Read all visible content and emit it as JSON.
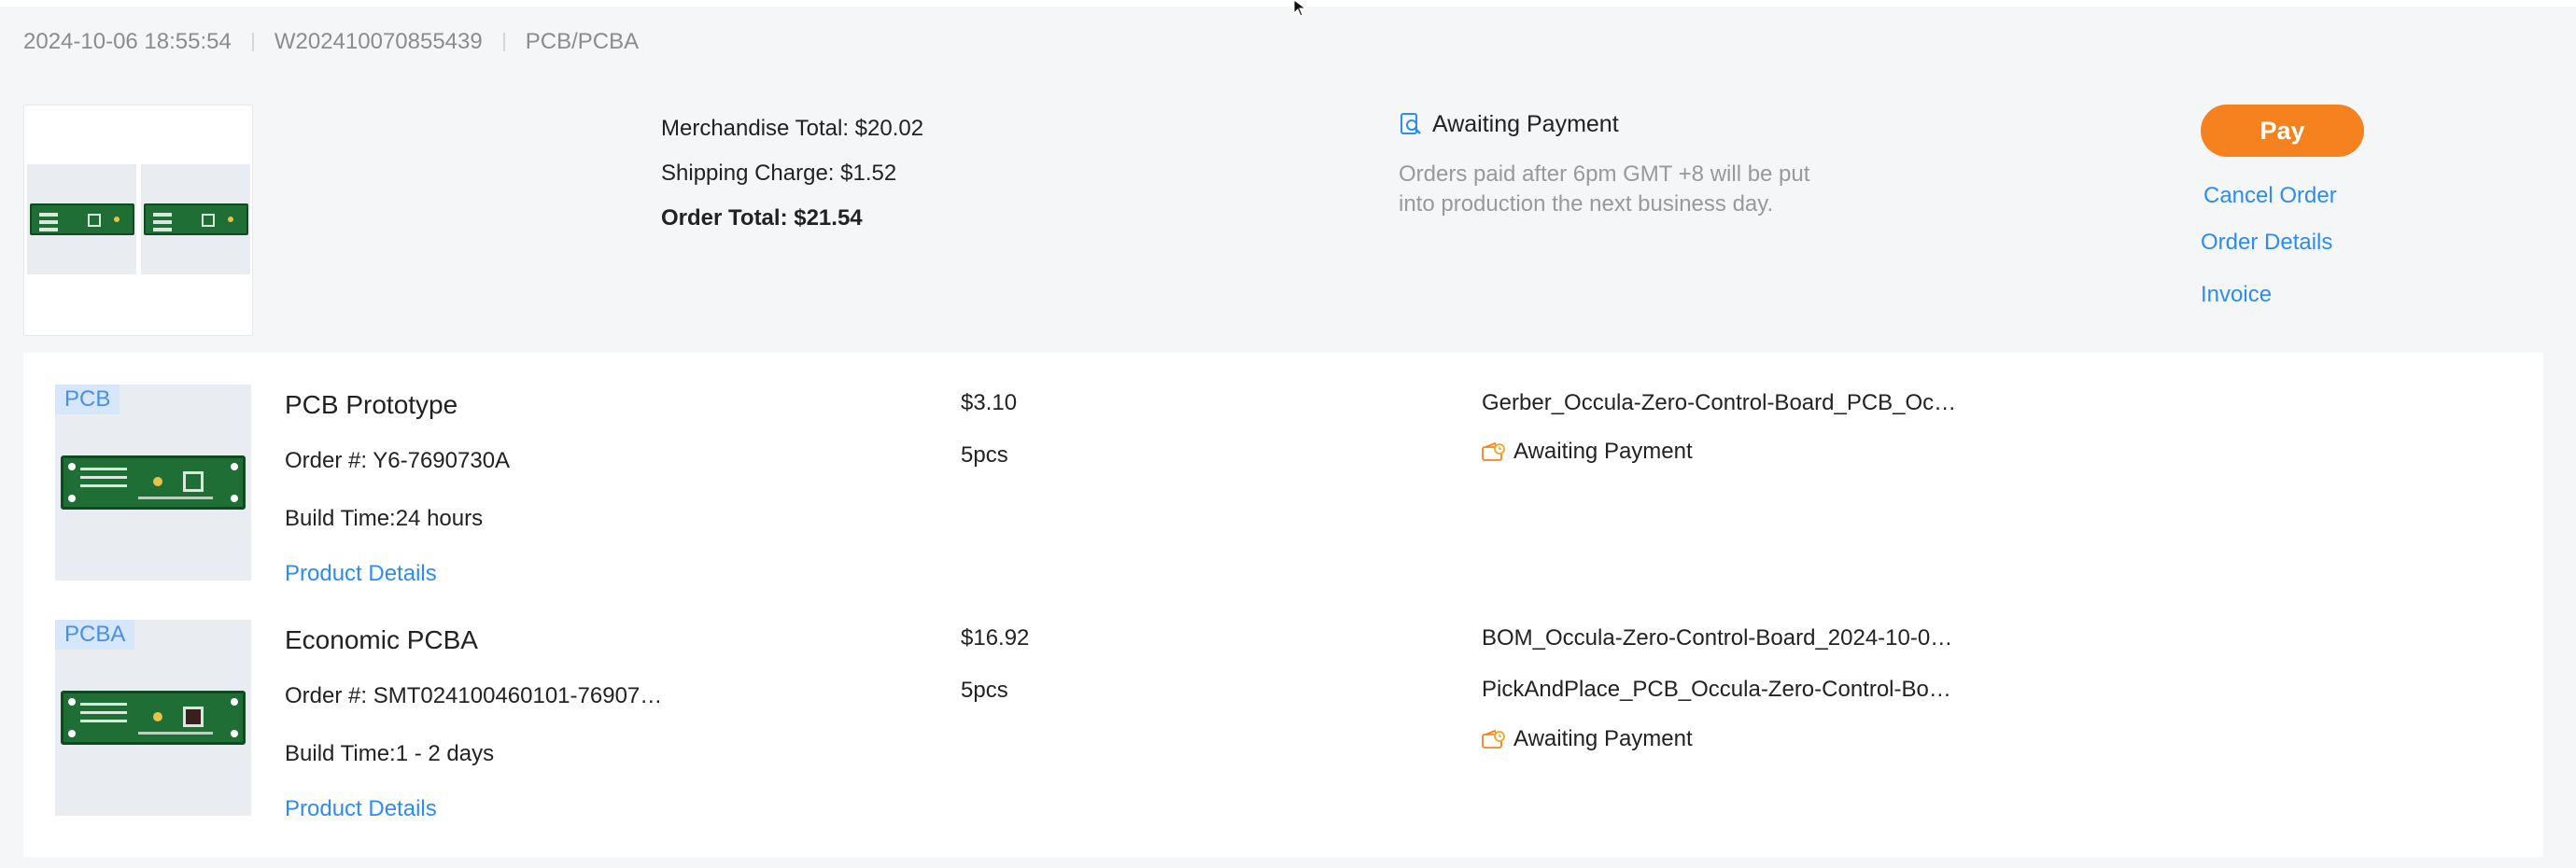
{
  "order_header": {
    "datetime": "2024-10-06 18:55:54",
    "order_id": "W202410070855439",
    "category": "PCB/PCBA"
  },
  "summary": {
    "merchandise_total": "Merchandise Total: $20.02",
    "shipping_charge": "Shipping Charge: $1.52",
    "order_total": "Order Total: $21.54",
    "status": "Awaiting Payment",
    "note_line1": "Orders paid after 6pm GMT +8 will be put",
    "note_line2": "into production the next business day."
  },
  "actions": {
    "pay": "Pay",
    "cancel": "Cancel Order",
    "details": "Order Details",
    "invoice": "Invoice"
  },
  "items": [
    {
      "tag": "PCB",
      "name": "PCB Prototype",
      "order_no": "Order #: Y6-7690730A",
      "build_time": "Build Time:24 hours",
      "details_link": "Product Details",
      "price": "$3.10",
      "qty": "5pcs",
      "files": [
        "Gerber_Occula-Zero-Control-Board_PCB_Oc…"
      ],
      "status": "Awaiting Payment"
    },
    {
      "tag": "PCBA",
      "name": "Economic PCBA",
      "order_no": "Order #: SMT024100460101-76907…",
      "build_time": "Build Time:1 - 2 days",
      "details_link": "Product Details",
      "price": "$16.92",
      "qty": "5pcs",
      "files": [
        "BOM_Occula-Zero-Control-Board_2024-10-0…",
        "PickAndPlace_PCB_Occula-Zero-Control-Bo…"
      ],
      "status": "Awaiting Payment"
    }
  ],
  "colors": {
    "accent_orange": "#f5821f",
    "link_blue": "#2d8cf0",
    "board_green": "#1f6e35",
    "tag_bg": "#d6e6fb"
  }
}
